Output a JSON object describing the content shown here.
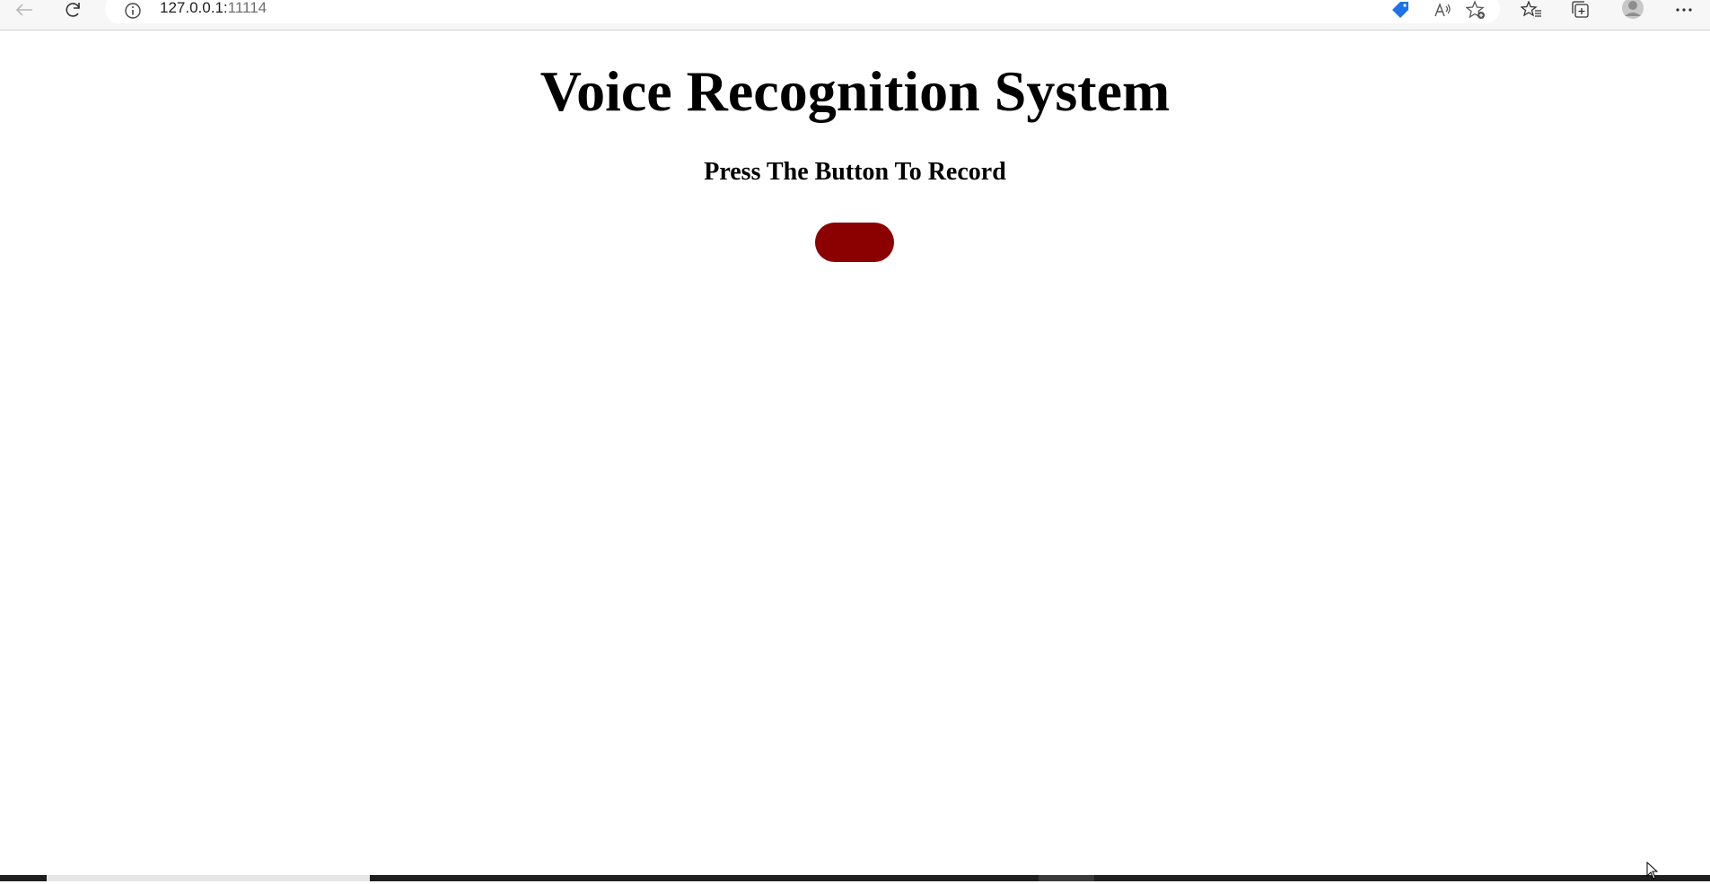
{
  "browser": {
    "address": {
      "host": "127.0.0.1:",
      "port": "11114"
    },
    "icons": [
      "back-icon",
      "refresh-icon",
      "site-info-icon",
      "coupon-tag-icon",
      "read-aloud-icon",
      "add-favorite-icon",
      "favorites-icon",
      "collections-icon",
      "profile-icon",
      "more-icon"
    ]
  },
  "page": {
    "title": "Voice Recognition System",
    "subtitle": "Press The Button To Record",
    "record_button_color": "#8b0000"
  }
}
